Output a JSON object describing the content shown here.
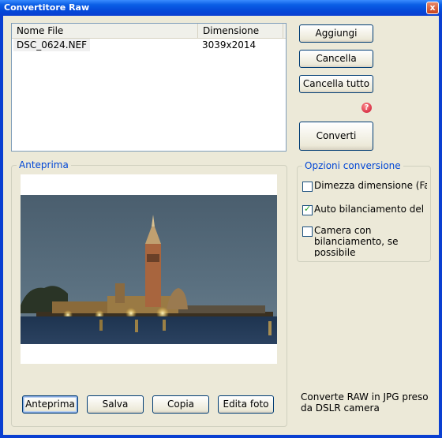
{
  "window": {
    "title": "Convertitore Raw",
    "close_label": "x"
  },
  "filelist": {
    "columns": [
      "Nome File",
      "Dimensione"
    ],
    "rows": [
      {
        "name": "DSC_0624.NEF",
        "size": "3039x2014"
      }
    ]
  },
  "actions": {
    "add": "Aggiungi",
    "remove": "Cancella",
    "remove_all": "Cancella tutto",
    "convert": "Converti",
    "help_glyph": "?"
  },
  "preview": {
    "title": "Anteprima",
    "buttons": {
      "preview": "Anteprima",
      "save": "Salva",
      "copy": "Copia",
      "edit": "Edita foto"
    }
  },
  "options": {
    "title": "Opzioni conversione",
    "items": [
      {
        "label": "Dimezza dimensione (Faste",
        "checked": false
      },
      {
        "label": "Auto bilanciamento del bia",
        "checked": true
      },
      {
        "label_line1": "Camera con",
        "label_line2": "bilanciamento, se",
        "label_line3": "possibile",
        "checked": false
      }
    ]
  },
  "info": {
    "line1": "Converte RAW in JPG preso",
    "line2": "da DSLR camera"
  },
  "colors": {
    "title_bar": "#0a5ee6",
    "face": "#ece9d8",
    "group_title": "#0046d5"
  }
}
